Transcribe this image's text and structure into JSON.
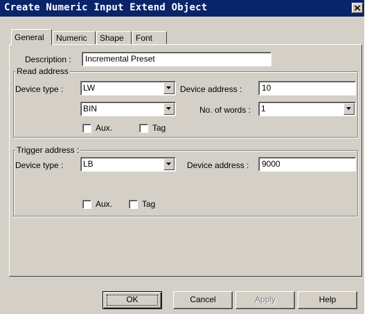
{
  "window": {
    "title": "Create Numeric Input Extend Object",
    "close_icon": "close-icon"
  },
  "tabs": [
    {
      "label": "General",
      "active": true
    },
    {
      "label": "Numeric",
      "active": false
    },
    {
      "label": "Shape",
      "active": false
    },
    {
      "label": "Font",
      "active": false
    }
  ],
  "general": {
    "description_label": "Description :",
    "description_value": "Incremental Preset",
    "read_address": {
      "legend": "Read address",
      "device_type_label": "Device type :",
      "device_type_value": "LW",
      "format_value": "BIN",
      "device_address_label": "Device address :",
      "device_address_value": "10",
      "no_of_words_label": "No. of words :",
      "no_of_words_value": "1",
      "aux_label": "Aux.",
      "aux_checked": false,
      "tag_label": "Tag",
      "tag_checked": false
    },
    "trigger_address": {
      "legend": "Trigger address :",
      "device_type_label": "Device type :",
      "device_type_value": "LB",
      "device_address_label": "Device  address :",
      "device_address_value": "9000",
      "aux_label": "Aux.",
      "aux_checked": false,
      "tag_label": "Tag",
      "tag_checked": false
    }
  },
  "buttons": {
    "ok": "OK",
    "cancel": "Cancel",
    "apply": "Apply",
    "help": "Help"
  },
  "colors": {
    "title_bar": "#0a246a",
    "face": "#d4d0c8",
    "disabled_text": "#808080"
  }
}
